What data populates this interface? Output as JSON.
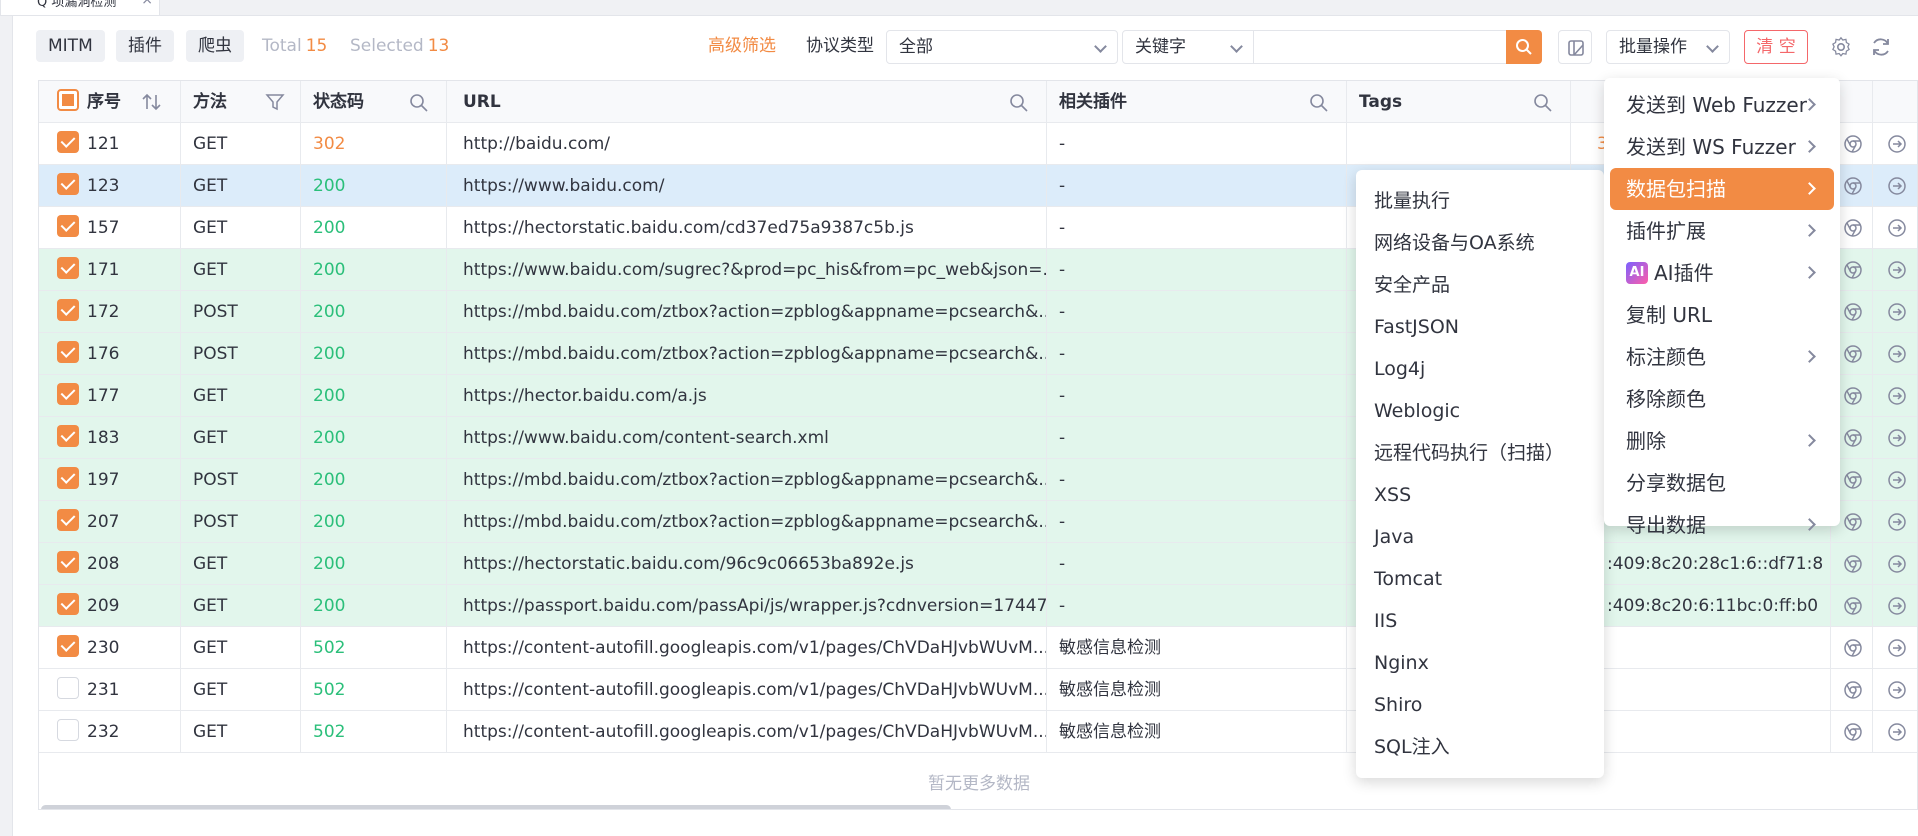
{
  "tab": {
    "title": "Q 项漏洞检测"
  },
  "toolbar": {
    "seg_mitm": "MITM",
    "seg_plugin": "插件",
    "seg_crawler": "爬虫",
    "total_label": "Total",
    "total_value": "15",
    "selected_label": "Selected",
    "selected_value": "13",
    "advanced_filter": "高级筛选",
    "protocol_label": "协议类型",
    "protocol_value": "全部",
    "keyword_select": "关键字",
    "keyword_input": "",
    "batch_label": "批量操作",
    "clear_label": "清 空"
  },
  "table": {
    "headers": {
      "index": "序号",
      "method": "方法",
      "status": "状态码",
      "url": "URL",
      "plugins": "相关插件",
      "tags": "Tags"
    },
    "rows": [
      {
        "id": "121",
        "method": "GET",
        "status": "302",
        "url": "http://baidu.com/",
        "plugin": "-"
      },
      {
        "id": "123",
        "method": "GET",
        "status": "200",
        "url": "https://www.baidu.com/",
        "plugin": "-"
      },
      {
        "id": "157",
        "method": "GET",
        "status": "200",
        "url": "https://hectorstatic.baidu.com/cd37ed75a9387c5b.js",
        "plugin": "-"
      },
      {
        "id": "171",
        "method": "GET",
        "status": "200",
        "url": "https://www.baidu.com/sugrec?&prod=pc_his&from=pc_web&json=...",
        "plugin": "-"
      },
      {
        "id": "172",
        "method": "POST",
        "status": "200",
        "url": "https://mbd.baidu.com/ztbox?action=zpblog&appname=pcsearch&...",
        "plugin": "-"
      },
      {
        "id": "176",
        "method": "POST",
        "status": "200",
        "url": "https://mbd.baidu.com/ztbox?action=zpblog&appname=pcsearch&...",
        "plugin": "-"
      },
      {
        "id": "177",
        "method": "GET",
        "status": "200",
        "url": "https://hector.baidu.com/a.js",
        "plugin": "-"
      },
      {
        "id": "183",
        "method": "GET",
        "status": "200",
        "url": "https://www.baidu.com/content-search.xml",
        "plugin": "-"
      },
      {
        "id": "197",
        "method": "POST",
        "status": "200",
        "url": "https://mbd.baidu.com/ztbox?action=zpblog&appname=pcsearch&...",
        "plugin": "-"
      },
      {
        "id": "207",
        "method": "POST",
        "status": "200",
        "url": "https://mbd.baidu.com/ztbox?action=zpblog&appname=pcsearch&...",
        "plugin": "-"
      },
      {
        "id": "208",
        "method": "GET",
        "status": "200",
        "url": "https://hectorstatic.baidu.com/96c9c06653ba892e.js",
        "plugin": "-",
        "partial": ":409:8c20:28c1:6::df71:8"
      },
      {
        "id": "209",
        "method": "GET",
        "status": "200",
        "url": "https://passport.baidu.com/passApi/js/wrapper.js?cdnversion=17447...",
        "plugin": "-",
        "partial": ":409:8c20:6:11bc:0:ff:b0"
      },
      {
        "id": "230",
        "method": "GET",
        "status": "502",
        "url": "https://content-autofill.googleapis.com/v1/pages/ChVDaHJvbWUvM...",
        "plugin": "敏感信息检测"
      },
      {
        "id": "231",
        "method": "GET",
        "status": "502",
        "url": "https://content-autofill.googleapis.com/v1/pages/ChVDaHJvbWUvM...",
        "plugin": "敏感信息检测"
      },
      {
        "id": "232",
        "method": "GET",
        "status": "502",
        "url": "https://content-autofill.googleapis.com/v1/pages/ChVDaHJvbWUvM...",
        "plugin": "敏感信息检测"
      }
    ],
    "row_partial_121": "3",
    "no_more": "暂无更多数据"
  },
  "batch_menu": [
    {
      "label": "发送到 Web Fuzzer"
    },
    {
      "label": "发送到 WS Fuzzer"
    },
    {
      "label": "数据包扫描"
    },
    {
      "label": "插件扩展"
    },
    {
      "label": "AI插件",
      "badge": "AI"
    },
    {
      "label": "复制 URL"
    },
    {
      "label": "标注颜色"
    },
    {
      "label": "移除颜色"
    },
    {
      "label": "删除"
    },
    {
      "label": "分享数据包"
    },
    {
      "label": "导出数据"
    }
  ],
  "scan_submenu": [
    "批量执行",
    "网络设备与OA系统",
    "安全产品",
    "FastJSON",
    "Log4j",
    "Weblogic",
    "远程代码执行（扫描）",
    "XSS",
    "Java",
    "Tomcat",
    "IIS",
    "Nginx",
    "Shiro",
    "SQL注入"
  ],
  "colors": {
    "accent": "#f28b44",
    "status_ok": "#2bbf7a",
    "danger": "#f4676a",
    "row_green": "#e2f6ec",
    "row_blue": "#dcecfa"
  }
}
